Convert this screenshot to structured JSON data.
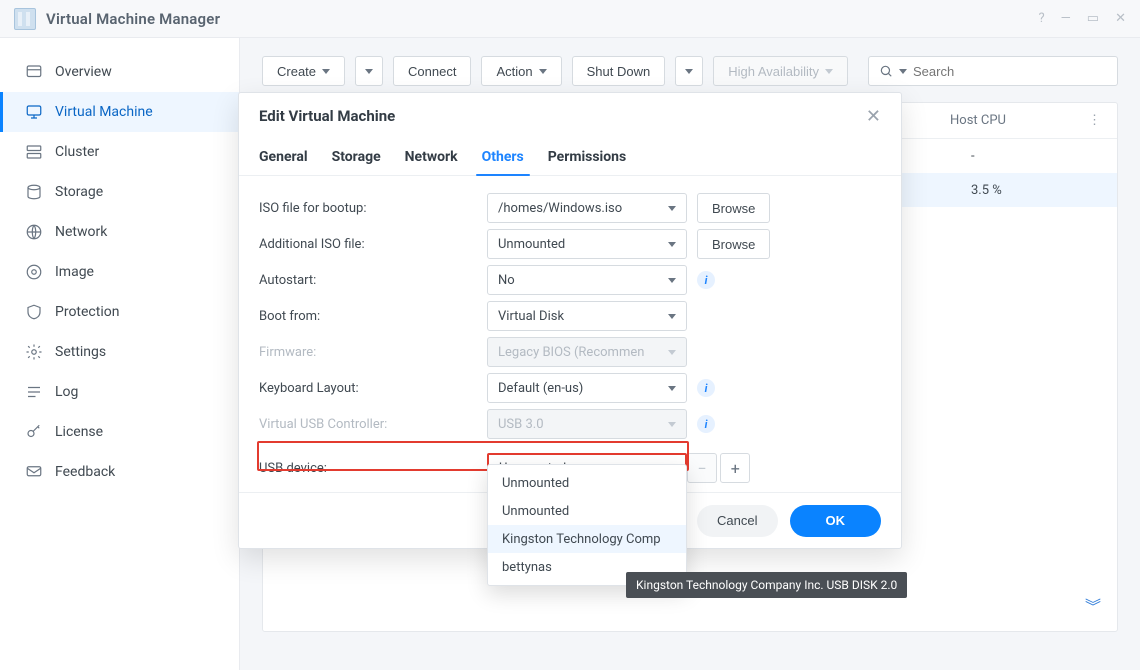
{
  "app": {
    "title": "Virtual Machine Manager"
  },
  "sidebar": {
    "items": [
      {
        "label": "Overview"
      },
      {
        "label": "Virtual Machine"
      },
      {
        "label": "Cluster"
      },
      {
        "label": "Storage"
      },
      {
        "label": "Network"
      },
      {
        "label": "Image"
      },
      {
        "label": "Protection"
      },
      {
        "label": "Settings"
      },
      {
        "label": "Log"
      },
      {
        "label": "License"
      },
      {
        "label": "Feedback"
      }
    ]
  },
  "toolbar": {
    "create": "Create",
    "connect": "Connect",
    "action": "Action",
    "shutdown": "Shut Down",
    "ha": "High Availability",
    "search_placeholder": "Search"
  },
  "grid": {
    "col_hostcpu": "Host CPU",
    "rows": [
      {
        "hostcpu": "-"
      },
      {
        "hostcpu": "3.5 %"
      }
    ]
  },
  "dialog": {
    "title": "Edit Virtual Machine",
    "tabs": {
      "general": "General",
      "storage": "Storage",
      "network": "Network",
      "others": "Others",
      "permissions": "Permissions"
    },
    "labels": {
      "iso_boot": "ISO file for bootup:",
      "iso_add": "Additional ISO file:",
      "autostart": "Autostart:",
      "boot_from": "Boot from:",
      "firmware": "Firmware:",
      "kb_layout": "Keyboard Layout:",
      "usb_ctrl": "Virtual USB Controller:",
      "usb_device": "USB device:"
    },
    "values": {
      "iso_boot": "/homes/Windows.iso",
      "iso_add": "Unmounted",
      "autostart": "No",
      "boot_from": "Virtual Disk",
      "firmware": "Legacy BIOS (Recommen",
      "kb_layout": "Default (en-us)",
      "usb_ctrl": "USB 3.0",
      "usb_device": "Unmounted"
    },
    "browse": "Browse",
    "cancel": "Cancel",
    "ok": "OK"
  },
  "usb_options": [
    "Unmounted",
    "Unmounted",
    "Kingston Technology Comp",
    "bettynas"
  ],
  "tooltip": "Kingston Technology Company Inc. USB DISK 2.0"
}
